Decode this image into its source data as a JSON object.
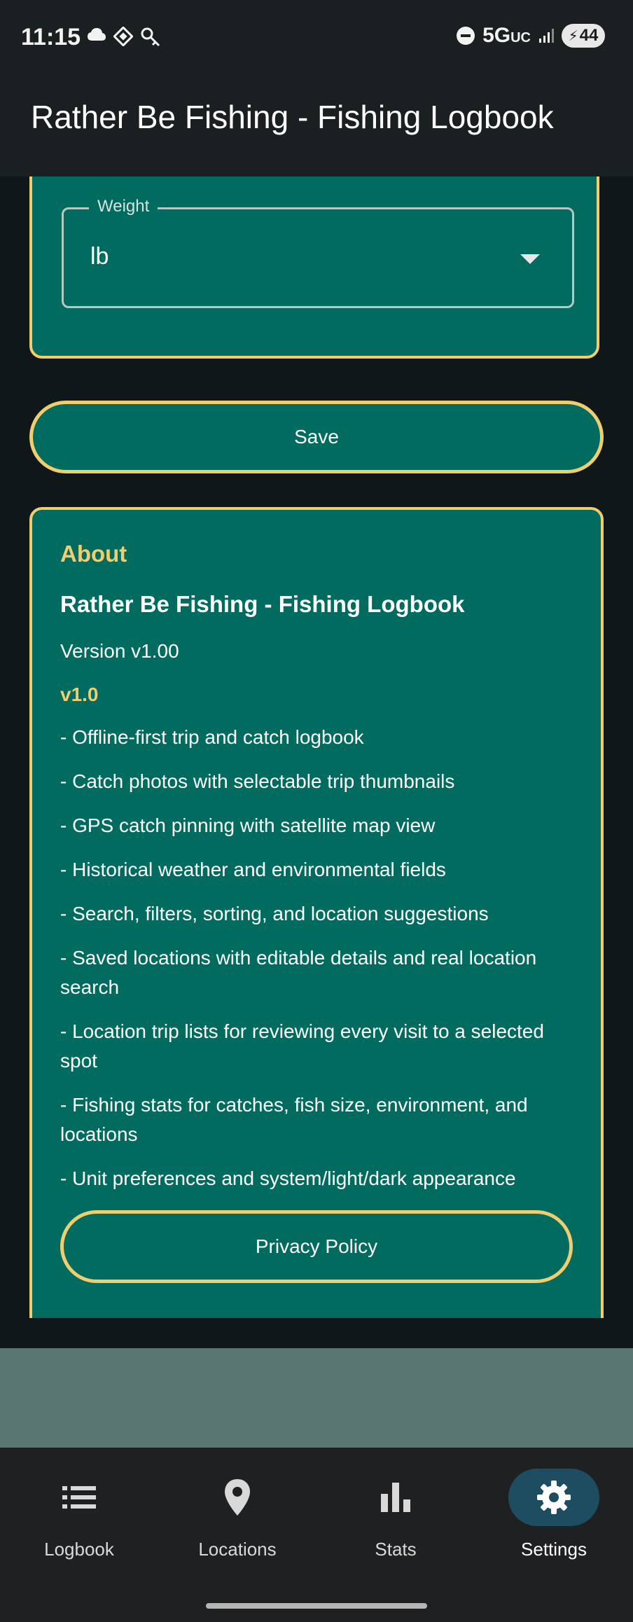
{
  "status_bar": {
    "time": "11:15",
    "network": "5G",
    "network_suffix": "UC",
    "battery": "44",
    "left_icons": [
      "cloud-icon",
      "vpn-diamond-icon",
      "key-icon"
    ],
    "right_icons": [
      "do-not-disturb-icon",
      "signal-icon",
      "battery-icon"
    ]
  },
  "app_bar": {
    "title": "Rather Be Fishing - Fishing Logbook"
  },
  "units": {
    "weight_label": "Weight",
    "weight_value": "lb"
  },
  "save_button": "Save",
  "about": {
    "heading": "About",
    "app_name": "Rather Be Fishing - Fishing Logbook",
    "version": "Version v1.00",
    "release_title": "v1.0",
    "notes": [
      "- Offline-first trip and catch logbook",
      "- Catch photos with selectable trip thumbnails",
      "- GPS catch pinning with satellite map view",
      "- Historical weather and environmental fields",
      "- Search, filters, sorting, and location suggestions",
      "- Saved locations with editable details and real location search",
      "- Location trip lists for reviewing every visit to a selected spot",
      "- Fishing stats for catches, fish size, environment, and locations",
      "- Unit preferences and system/light/dark appearance"
    ],
    "privacy_button": "Privacy Policy"
  },
  "bottom_nav": {
    "items": [
      {
        "label": "Logbook",
        "icon": "list-icon",
        "active": false
      },
      {
        "label": "Locations",
        "icon": "location-pin-icon",
        "active": false
      },
      {
        "label": "Stats",
        "icon": "bar-chart-icon",
        "active": false
      },
      {
        "label": "Settings",
        "icon": "gear-icon",
        "active": true
      }
    ]
  },
  "colors": {
    "accent": "#f0cd6f",
    "card": "#006b5e",
    "background": "#0f1718",
    "nav_active": "#1e4d61"
  }
}
